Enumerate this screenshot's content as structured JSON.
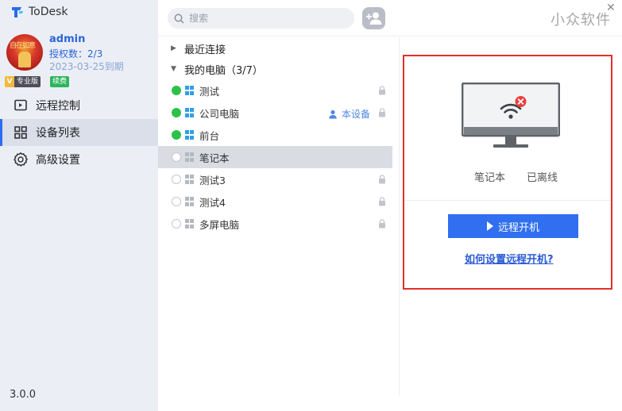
{
  "app": {
    "title": "ToDesk",
    "version": "3.0.0",
    "watermark": "小众软件",
    "brand_color": "#2c6df2"
  },
  "user": {
    "name": "admin",
    "auth_count": "授权数：2/3",
    "expire": "2023-03-25到期",
    "badge_pro_v": "V",
    "badge_pro": "专业版",
    "badge_renew": "续费",
    "avatar_chars": "自在如意"
  },
  "nav": [
    {
      "label": "远程控制",
      "icon": "remote-control-icon"
    },
    {
      "label": "设备列表",
      "icon": "grid-icon"
    },
    {
      "label": "高级设置",
      "icon": "gear-icon"
    }
  ],
  "search": {
    "placeholder": "搜索"
  },
  "tree": {
    "recent_label": "最近连接",
    "my_devices_label": "我的电脑（3/7）",
    "devices": [
      {
        "name": "测试",
        "online": true,
        "locked": true
      },
      {
        "name": "公司电脑",
        "online": true,
        "locked": true,
        "self_tag": "本设备"
      },
      {
        "name": "前台",
        "online": true,
        "locked": false
      },
      {
        "name": "笔记本",
        "online": false,
        "locked": false,
        "selected": true
      },
      {
        "name": "测试3",
        "online": false,
        "locked": true
      },
      {
        "name": "测试4",
        "online": false,
        "locked": true
      },
      {
        "name": "多屏电脑",
        "online": false,
        "locked": true
      }
    ]
  },
  "detail": {
    "device_name": "笔记本",
    "status": "已离线",
    "wake_button": "远程开机",
    "help_link": "如何设置远程开机?"
  }
}
